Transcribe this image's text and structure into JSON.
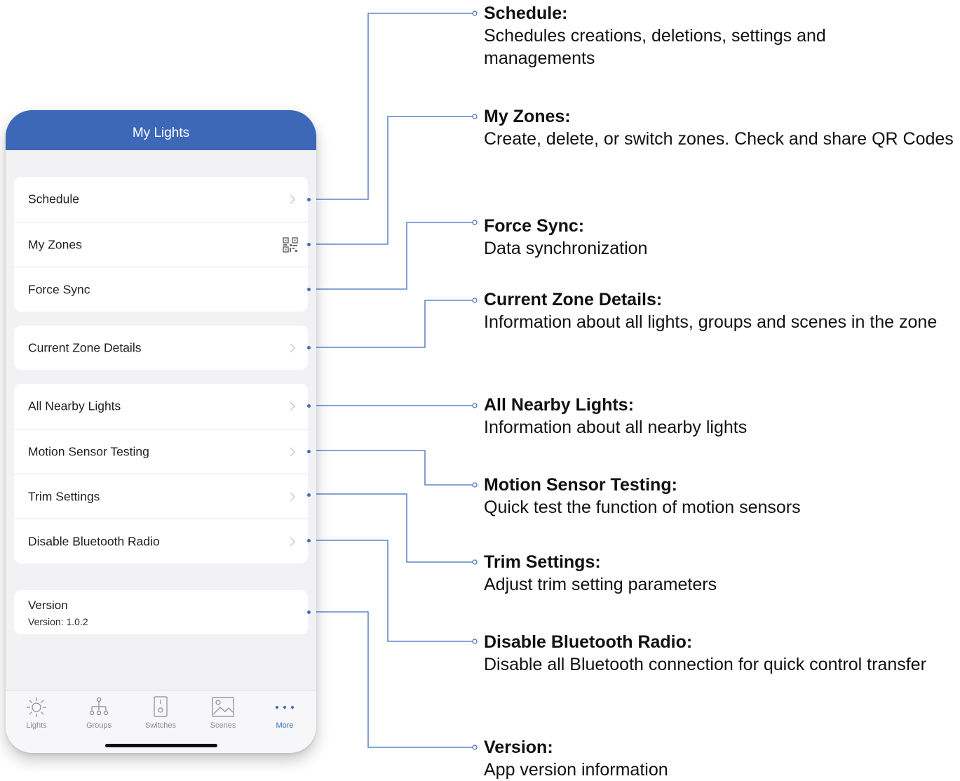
{
  "colors": {
    "accent": "#3d68b8",
    "leader_line": "#3f6dc0",
    "tab_active": "#3a67c4"
  },
  "phone": {
    "nav_title": "My Lights",
    "menu_group_1": [
      {
        "label": "Schedule",
        "accessory": "chevron-right-icon"
      },
      {
        "label": "My Zones",
        "accessory": "qr-code-icon"
      },
      {
        "label": "Force Sync",
        "accessory": "none"
      }
    ],
    "menu_group_2": [
      {
        "label": "Current Zone Details",
        "accessory": "chevron-right-icon"
      }
    ],
    "menu_group_3": [
      {
        "label": "All Nearby Lights",
        "accessory": "chevron-right-icon"
      },
      {
        "label": "Motion Sensor Testing",
        "accessory": "chevron-right-icon"
      },
      {
        "label": "Trim Settings",
        "accessory": "chevron-right-icon"
      },
      {
        "label": "Disable Bluetooth Radio",
        "accessory": "chevron-right-icon"
      }
    ],
    "version": {
      "title": "Version",
      "value": "Version: 1.0.2"
    },
    "tabs": [
      {
        "label": "Lights",
        "icon": "sun-icon",
        "active": false
      },
      {
        "label": "Groups",
        "icon": "hierarchy-icon",
        "active": false
      },
      {
        "label": "Switches",
        "icon": "switch-icon",
        "active": false
      },
      {
        "label": "Scenes",
        "icon": "image-icon",
        "active": false
      },
      {
        "label": "More",
        "icon": "more-dots-icon",
        "active": true
      }
    ]
  },
  "annotations": [
    {
      "title": "Schedule:",
      "desc": "Schedules creations, deletions, settings and managements"
    },
    {
      "title": "My Zones:",
      "desc": "Create, delete, or switch zones. Check and share QR Codes"
    },
    {
      "title": "Force Sync:",
      "desc": "Data synchronization"
    },
    {
      "title": "Current Zone Details:",
      "desc": "Information about all lights, groups and scenes in the zone"
    },
    {
      "title": "All Nearby Lights:",
      "desc": "Information about all nearby lights"
    },
    {
      "title": "Motion Sensor Testing:",
      "desc": "Quick test the function of motion sensors"
    },
    {
      "title": "Trim Settings:",
      "desc": "Adjust trim setting parameters"
    },
    {
      "title": "Disable Bluetooth Radio:",
      "desc": "Disable all Bluetooth connection for quick control transfer"
    },
    {
      "title": "Version:",
      "desc": "App version information"
    }
  ]
}
